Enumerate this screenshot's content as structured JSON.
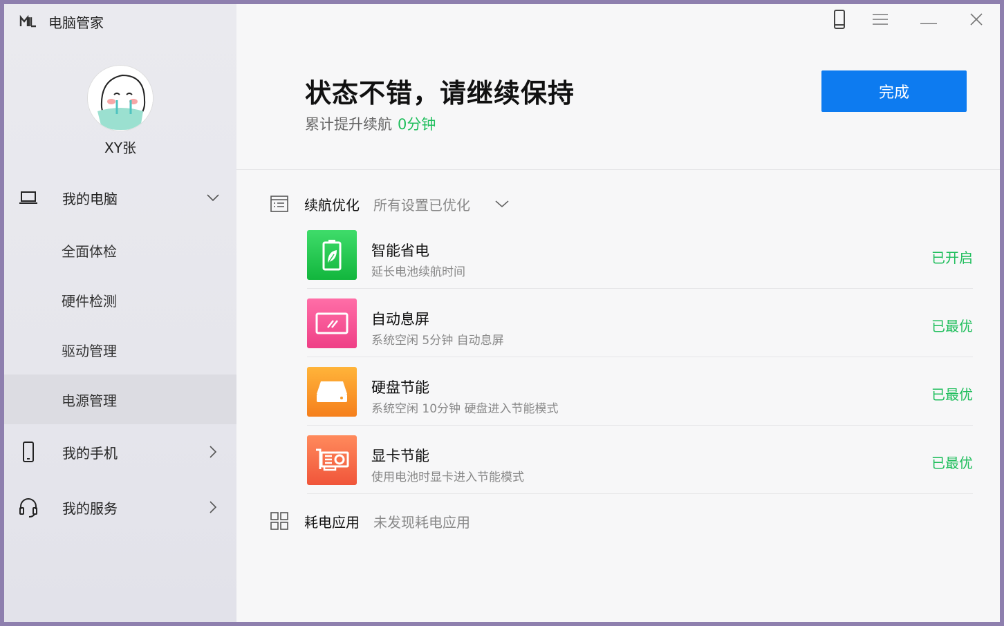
{
  "app": {
    "name": "电脑管家"
  },
  "titlebar": {
    "phone_icon": "phone-icon",
    "menu_icon": "menu-icon",
    "minimize_icon": "minimize-icon",
    "close_icon": "close-icon"
  },
  "user": {
    "name": "XY张"
  },
  "sidebar": {
    "my_pc": {
      "label": "我的电脑",
      "icon": "laptop-icon"
    },
    "sub_items": [
      {
        "label": "全面体检"
      },
      {
        "label": "硬件检测"
      },
      {
        "label": "驱动管理"
      },
      {
        "label": "电源管理"
      }
    ],
    "my_phone": {
      "label": "我的手机",
      "icon": "phone-icon"
    },
    "my_service": {
      "label": "我的服务",
      "icon": "headset-icon"
    }
  },
  "header": {
    "headline": "状态不错，请继续保持",
    "sub_prefix": "累计提升续航",
    "sub_value": "0分钟",
    "done_label": "完成"
  },
  "section_battery": {
    "label": "续航优化",
    "status": "所有设置已优化"
  },
  "items": [
    {
      "title": "智能省电",
      "desc": "延长电池续航时间",
      "state": "已开启",
      "icon": "battery-leaf-icon",
      "color_from": "#3fdc6a",
      "color_to": "#12b63d"
    },
    {
      "title": "自动息屏",
      "desc": "系统空闲 5分钟 自动息屏",
      "state": "已最优",
      "icon": "screen-icon",
      "color_from": "#ff6ea7",
      "color_to": "#ef3f86"
    },
    {
      "title": "硬盘节能",
      "desc": "系统空闲 10分钟 硬盘进入节能模式",
      "state": "已最优",
      "icon": "harddisk-icon",
      "color_from": "#ffb43a",
      "color_to": "#f57f1c"
    },
    {
      "title": "显卡节能",
      "desc": "使用电池时显卡进入节能模式",
      "state": "已最优",
      "icon": "graphics-card-icon",
      "color_from": "#ff8a5c",
      "color_to": "#f0553a"
    }
  ],
  "section_apps": {
    "label": "耗电应用",
    "status": "未发现耗电应用"
  },
  "colors": {
    "accent_blue": "#0d7bf0",
    "status_green": "#1fbe5c"
  }
}
